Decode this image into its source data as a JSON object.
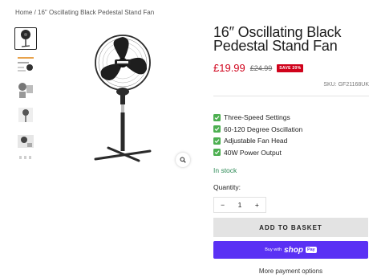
{
  "breadcrumb": {
    "home": "Home",
    "separator": " / ",
    "current": "16\" Oscillating Black Pedestal Stand Fan"
  },
  "product": {
    "title": "16″ Oscillating Black Pedestal Stand Fan",
    "price": "£19.99",
    "old_price": "£24.99",
    "sale_badge": "SAVE 20%",
    "sku": "SKU: GF21168UK",
    "features": [
      "Three-Speed Settings",
      "60-120 Degree Oscillation",
      "Adjustable Fan Head",
      "40W Power Output"
    ],
    "stock": "In stock"
  },
  "quantity": {
    "label": "Quantity:",
    "minus": "−",
    "value": "1",
    "plus": "+"
  },
  "buttons": {
    "add_to_basket": "ADD TO BASKET",
    "buy_with": "Buy with",
    "shop": "shop",
    "pay": "Pay",
    "more_payment": "More payment options"
  },
  "colors": {
    "price": "#d0021b",
    "stock": "#2e8b57",
    "shop_pay": "#5a31f4",
    "check": "#4caf50"
  },
  "icons": {
    "zoom": "magnifier-icon",
    "feature": "check-icon"
  }
}
